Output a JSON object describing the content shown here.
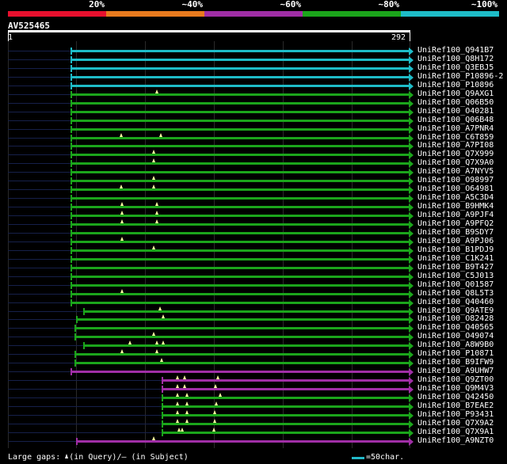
{
  "legend": {
    "labels": [
      "20%",
      "~40%",
      "~60%",
      "~80%",
      "~100%"
    ],
    "colors": [
      "#e8102e",
      "#e87a1e",
      "#a02ea6",
      "#1ba51b",
      "#1ebcc8"
    ]
  },
  "query": {
    "id": "AV525465",
    "start": "1",
    "end": "292"
  },
  "hits": [
    {
      "id": "UniRef100_Q941B7",
      "color": "#1ebcc8",
      "seg": [
        89,
        516
      ],
      "marks": []
    },
    {
      "id": "UniRef100_Q8H172",
      "color": "#1ebcc8",
      "seg": [
        89,
        516
      ],
      "marks": []
    },
    {
      "id": "UniRef100_Q3EBJ5",
      "color": "#1ebcc8",
      "seg": [
        89,
        516
      ],
      "marks": []
    },
    {
      "id": "UniRef100_P10896-2",
      "color": "#1ebcc8",
      "seg": [
        89,
        516
      ],
      "marks": []
    },
    {
      "id": "UniRef100_P10896",
      "color": "#1ebcc8",
      "seg": [
        89,
        516
      ],
      "marks": []
    },
    {
      "id": "UniRef100_Q9AXG1",
      "color": "#1ba51b",
      "seg": [
        89,
        516
      ],
      "marks": [
        198
      ]
    },
    {
      "id": "UniRef100_Q06B50",
      "color": "#1ba51b",
      "seg": [
        89,
        516
      ],
      "marks": []
    },
    {
      "id": "UniRef100_O40281",
      "color": "#1ba51b",
      "seg": [
        89,
        516
      ],
      "marks": []
    },
    {
      "id": "UniRef100_Q06B48",
      "color": "#1ba51b",
      "seg": [
        89,
        516
      ],
      "marks": []
    },
    {
      "id": "UniRef100_A7PNR4",
      "color": "#1ba51b",
      "seg": [
        89,
        516
      ],
      "marks": []
    },
    {
      "id": "UniRef100_C6T859",
      "color": "#1ba51b",
      "seg": [
        89,
        516
      ],
      "marks": [
        153,
        203
      ]
    },
    {
      "id": "UniRef100_A7PI08",
      "color": "#1ba51b",
      "seg": [
        89,
        516
      ],
      "marks": []
    },
    {
      "id": "UniRef100_Q7X999",
      "color": "#1ba51b",
      "seg": [
        89,
        516
      ],
      "marks": [
        194
      ]
    },
    {
      "id": "UniRef100_Q7X9A0",
      "color": "#1ba51b",
      "seg": [
        89,
        516
      ],
      "marks": [
        194
      ]
    },
    {
      "id": "UniRef100_A7NYV5",
      "color": "#1ba51b",
      "seg": [
        89,
        516
      ],
      "marks": []
    },
    {
      "id": "UniRef100_O98997",
      "color": "#1ba51b",
      "seg": [
        89,
        516
      ],
      "marks": [
        194
      ]
    },
    {
      "id": "UniRef100_O64981",
      "color": "#1ba51b",
      "seg": [
        89,
        516
      ],
      "marks": [
        153,
        194
      ]
    },
    {
      "id": "UniRef100_A5C3D4",
      "color": "#1ba51b",
      "seg": [
        89,
        516
      ],
      "marks": []
    },
    {
      "id": "UniRef100_B9HMK4",
      "color": "#1ba51b",
      "seg": [
        89,
        516
      ],
      "marks": [
        154,
        198
      ]
    },
    {
      "id": "UniRef100_A9PJF4",
      "color": "#1ba51b",
      "seg": [
        89,
        516
      ],
      "marks": [
        154,
        198
      ]
    },
    {
      "id": "UniRef100_A9PFQ2",
      "color": "#1ba51b",
      "seg": [
        89,
        516
      ],
      "marks": [
        154,
        198
      ]
    },
    {
      "id": "UniRef100_B9SDY7",
      "color": "#1ba51b",
      "seg": [
        89,
        516
      ],
      "marks": []
    },
    {
      "id": "UniRef100_A9PJ06",
      "color": "#1ba51b",
      "seg": [
        89,
        516
      ],
      "marks": [
        154
      ]
    },
    {
      "id": "UniRef100_B1PDJ9",
      "color": "#1ba51b",
      "seg": [
        89,
        516
      ],
      "marks": [
        194
      ]
    },
    {
      "id": "UniRef100_C1K241",
      "color": "#1ba51b",
      "seg": [
        89,
        516
      ],
      "marks": []
    },
    {
      "id": "UniRef100_B9T427",
      "color": "#1ba51b",
      "seg": [
        89,
        516
      ],
      "marks": []
    },
    {
      "id": "UniRef100_C5J013",
      "color": "#1ba51b",
      "seg": [
        89,
        516
      ],
      "marks": []
    },
    {
      "id": "UniRef100_Q01587",
      "color": "#1ba51b",
      "seg": [
        89,
        516
      ],
      "marks": []
    },
    {
      "id": "UniRef100_Q8L5T3",
      "color": "#1ba51b",
      "seg": [
        89,
        516
      ],
      "marks": [
        154
      ]
    },
    {
      "id": "UniRef100_Q40460",
      "color": "#1ba51b",
      "seg": [
        89,
        516
      ],
      "marks": []
    },
    {
      "id": "UniRef100_Q9ATE9",
      "color": "#1ba51b",
      "seg": [
        105,
        516
      ],
      "marks": [
        202
      ]
    },
    {
      "id": "UniRef100_O82428",
      "color": "#1ba51b",
      "seg": [
        96,
        516
      ],
      "marks": [
        206
      ]
    },
    {
      "id": "UniRef100_Q40565",
      "color": "#1ba51b",
      "seg": [
        94,
        516
      ],
      "marks": []
    },
    {
      "id": "UniRef100_O49074",
      "color": "#1ba51b",
      "seg": [
        94,
        516
      ],
      "marks": [
        194
      ]
    },
    {
      "id": "UniRef100_A8W9B0",
      "color": "#1ba51b",
      "seg": [
        105,
        516
      ],
      "marks": [
        164,
        198,
        206
      ]
    },
    {
      "id": "UniRef100_P10871",
      "color": "#1ba51b",
      "seg": [
        94,
        516
      ],
      "marks": [
        154,
        198
      ]
    },
    {
      "id": "UniRef100_B9IFW9",
      "color": "#1ba51b",
      "seg": [
        94,
        516
      ],
      "marks": [
        204
      ]
    },
    {
      "id": "UniRef100_A9UHW7",
      "color": "#a02ea6",
      "seg": [
        89,
        516
      ],
      "marks": []
    },
    {
      "id": "UniRef100_Q9ZT00",
      "color": "#a02ea6",
      "seg": [
        204,
        516
      ],
      "marks": [
        224,
        233,
        275
      ]
    },
    {
      "id": "UniRef100_Q9M4V3",
      "color": "#a02ea6",
      "seg": [
        204,
        516
      ],
      "marks": [
        224,
        233,
        272
      ]
    },
    {
      "id": "UniRef100_Q42450",
      "color": "#1ba51b",
      "seg": [
        204,
        516
      ],
      "marks": [
        224,
        236,
        278
      ]
    },
    {
      "id": "UniRef100_B7EAE2",
      "color": "#1ba51b",
      "seg": [
        204,
        516
      ],
      "marks": [
        224,
        236,
        273
      ]
    },
    {
      "id": "UniRef100_P93431",
      "color": "#1ba51b",
      "seg": [
        204,
        516
      ],
      "marks": [
        224,
        236,
        271
      ]
    },
    {
      "id": "UniRef100_Q7X9A2",
      "color": "#1ba51b",
      "seg": [
        204,
        516
      ],
      "marks": [
        224,
        236,
        271
      ]
    },
    {
      "id": "UniRef100_Q7X9A1",
      "color": "#1ba51b",
      "seg": [
        204,
        516
      ],
      "marks": [
        226,
        230,
        270
      ]
    },
    {
      "id": "UniRef100_A9NZT0",
      "color": "#a02ea6",
      "seg": [
        96,
        516
      ],
      "marks": [
        194
      ]
    }
  ],
  "footer": {
    "gaps_prefix": "Large gaps: ",
    "gaps_suffix": "(in Query)/– (in Subject)",
    "scale_label": "=50char."
  }
}
